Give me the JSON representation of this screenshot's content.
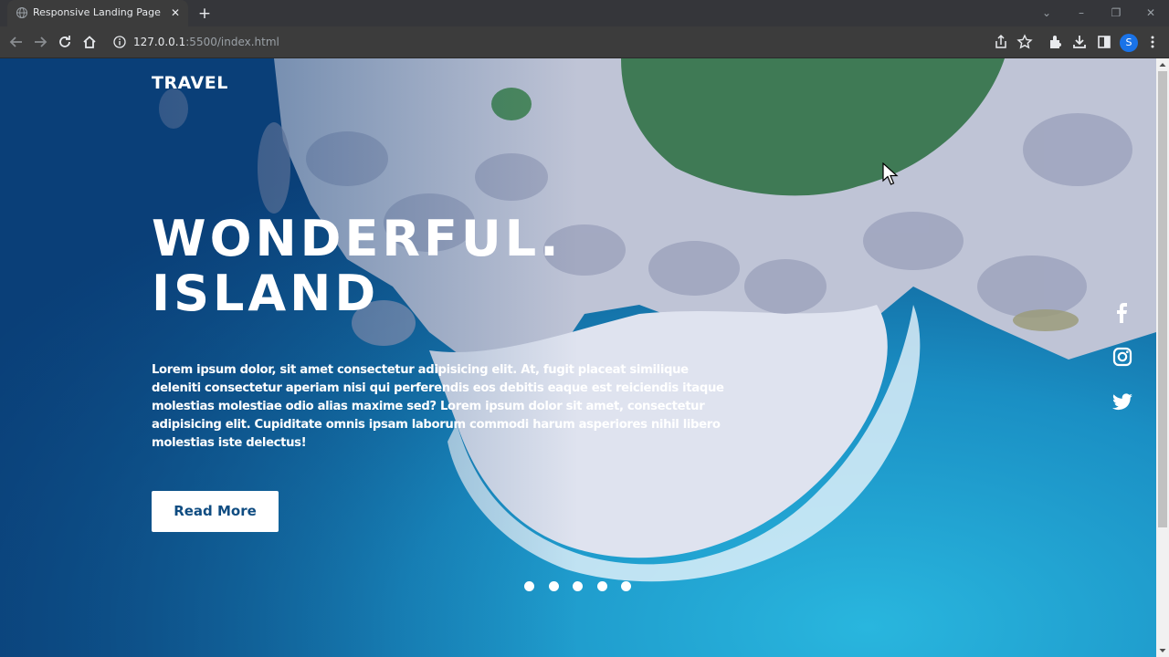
{
  "browser": {
    "tab_title": "Responsive Landing Page",
    "url_host": "127.0.0.1",
    "url_rest": ":5500/index.html",
    "profile_initial": "S"
  },
  "page": {
    "logo": "TRAVEL",
    "hero_line1": "WONDERFUL.",
    "hero_line2": "ISLAND",
    "description": "Lorem ipsum dolor, sit amet consectetur adipisicing elit. At, fugit placeat similique deleniti consectetur aperiam nisi qui perferendis eos debitis eaque est reiciendis itaque molestias molestiae odio alias maxime sed? Lorem ipsum dolor sit amet, consectetur adipisicing elit. Cupiditate omnis ipsam laborum commodi harum asperiores nihil libero molestias iste delectus!",
    "cta_label": "Read More",
    "social_icons": [
      "facebook-icon",
      "instagram-icon",
      "twitter-icon"
    ],
    "slider_dots": 5
  },
  "colors": {
    "sea": "#1a8fc4",
    "deep_sea": "#0a3f78",
    "sand": "#dfe3ef",
    "rock": "#c5c9d8",
    "cta_text": "#0f4c81"
  }
}
